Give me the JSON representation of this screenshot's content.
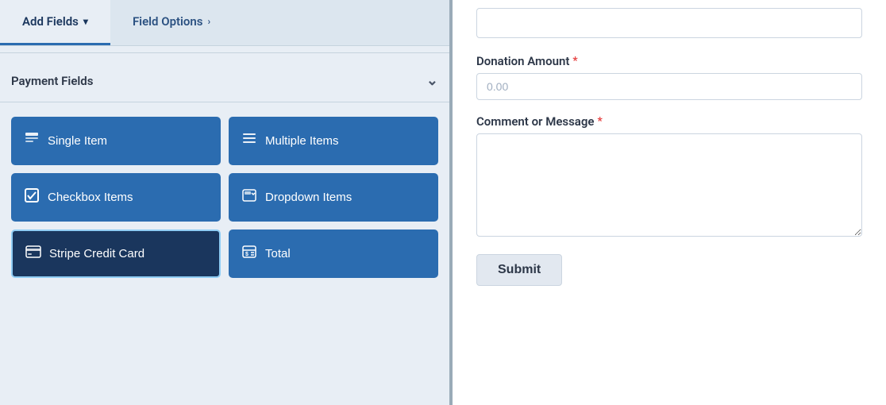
{
  "tabs": {
    "add_fields": {
      "label": "Add Fields",
      "chevron": "▾"
    },
    "field_options": {
      "label": "Field Options",
      "chevron": "›"
    }
  },
  "payment_fields": {
    "header": "Payment Fields",
    "chevron": "⌄",
    "buttons": [
      {
        "id": "single-item",
        "icon": "📄",
        "label": "Single Item",
        "icon_symbol": "file"
      },
      {
        "id": "multiple-items",
        "icon": "≡",
        "label": "Multiple Items",
        "icon_symbol": "list"
      },
      {
        "id": "checkbox-items",
        "icon": "☑",
        "label": "Checkbox Items",
        "icon_symbol": "checkbox"
      },
      {
        "id": "dropdown-items",
        "icon": "▣",
        "label": "Dropdown Items",
        "icon_symbol": "dropdown"
      },
      {
        "id": "stripe-credit-card",
        "icon": "💳",
        "label": "Stripe Credit Card",
        "icon_symbol": "card"
      },
      {
        "id": "total",
        "icon": "💰",
        "label": "Total",
        "icon_symbol": "total"
      }
    ]
  },
  "form": {
    "donation_amount_label": "Donation Amount",
    "donation_amount_placeholder": "0.00",
    "comment_label": "Comment or Message",
    "submit_label": "Submit"
  }
}
